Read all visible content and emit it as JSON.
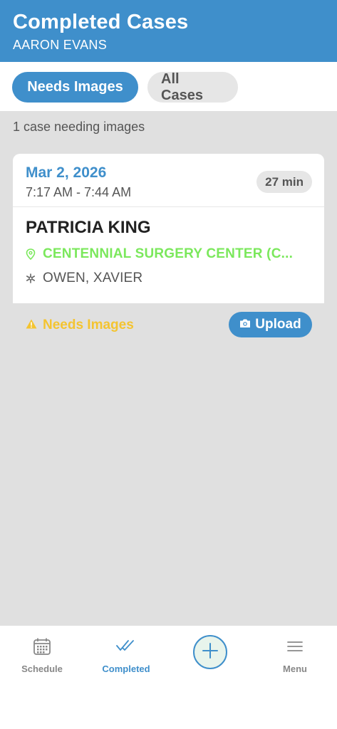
{
  "header": {
    "title": "Completed Cases",
    "subtitle": "AARON EVANS"
  },
  "filters": {
    "needs_images": "Needs Images",
    "all_cases": "All Cases"
  },
  "summary": {
    "count_text": "1 case needing images"
  },
  "cases": [
    {
      "date": "Mar 2, 2026",
      "time_range": "7:17 AM - 7:44 AM",
      "duration": "27 min",
      "patient": "PATRICIA KING",
      "facility": "CENTENNIAL SURGERY CENTER (C...",
      "doctor": "OWEN, XAVIER",
      "status": "Needs Images",
      "upload_label": "Upload"
    }
  ],
  "tabbar": {
    "schedule": "Schedule",
    "completed": "Completed",
    "menu": "Menu"
  },
  "colors": {
    "accent": "#3f8fcb",
    "facility": "#7be85c",
    "warning": "#f4c430",
    "background": "#e0e0e0"
  },
  "icons": {
    "schedule": "calendar-icon",
    "completed": "double-check-icon",
    "add": "plus-icon",
    "menu": "hamburger-icon",
    "location": "map-pin-icon",
    "doctor": "staff-icon",
    "warning": "warning-icon",
    "camera": "camera-icon"
  }
}
